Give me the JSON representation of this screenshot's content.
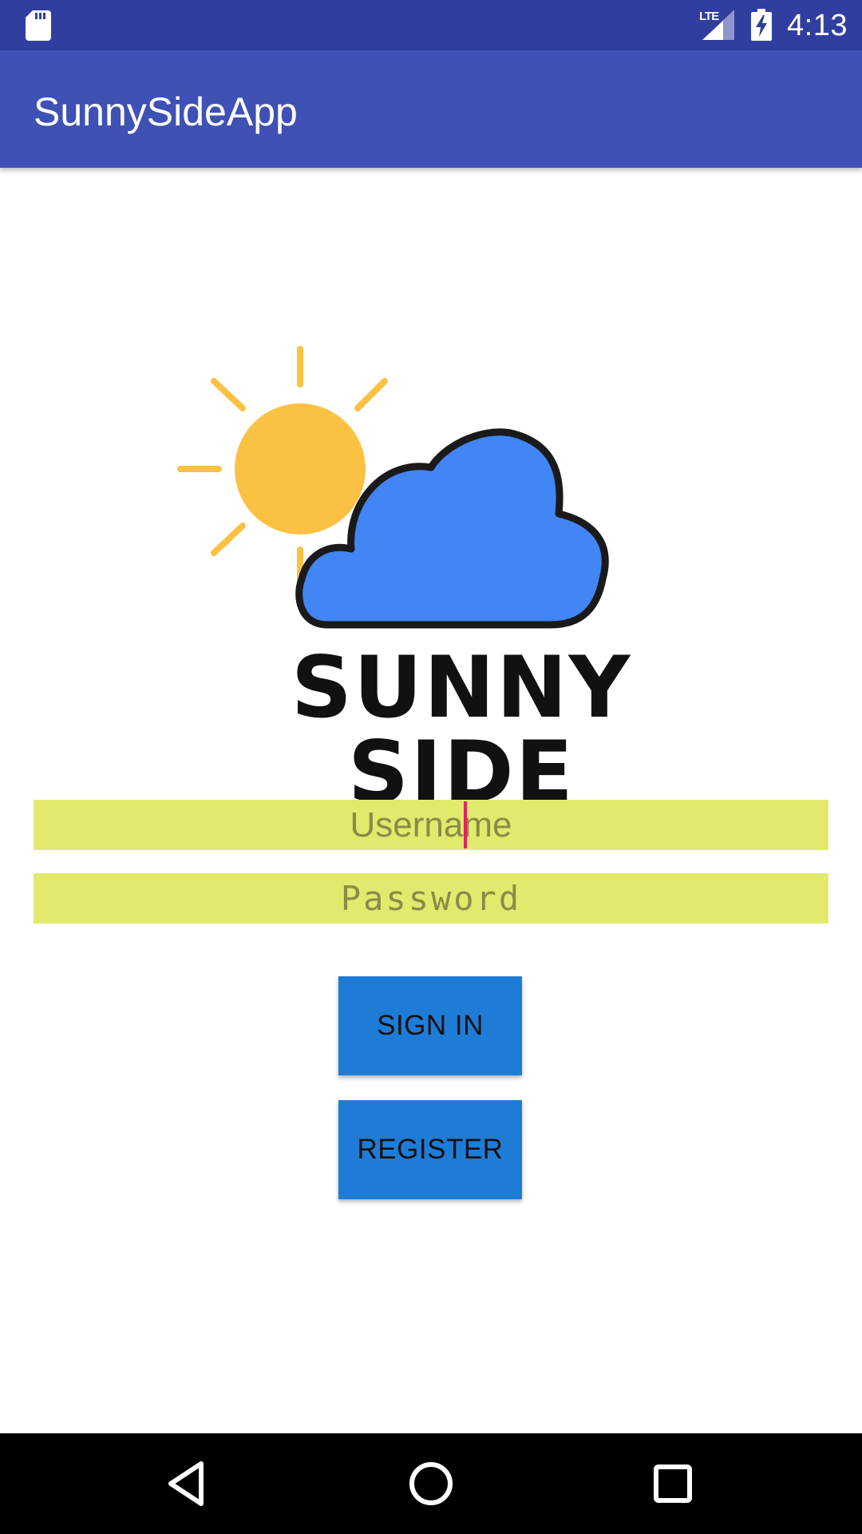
{
  "status_bar": {
    "network_label": "LTE",
    "time": "4:13",
    "icons": [
      "sd-card-icon",
      "signal-icon",
      "battery-charging-icon"
    ]
  },
  "app_bar": {
    "title": "SunnySideApp",
    "color": "#3F51B5",
    "status_color": "#303F9F"
  },
  "logo": {
    "text": "SUNNY SIDE",
    "icons": [
      "sun-icon",
      "cloud-icon"
    ],
    "sun_color": "#FBC143",
    "cloud_color": "#4285F4"
  },
  "form": {
    "username_placeholder": "Username",
    "password_placeholder": "Password",
    "field_color": "#E1EA6C",
    "cursor_color": "#E91E63"
  },
  "buttons": {
    "sign_in": "SIGN IN",
    "register": "REGISTER",
    "color": "#1E7CD6"
  },
  "nav_bar": {
    "icons": [
      "back-icon",
      "home-icon",
      "recents-icon"
    ]
  }
}
